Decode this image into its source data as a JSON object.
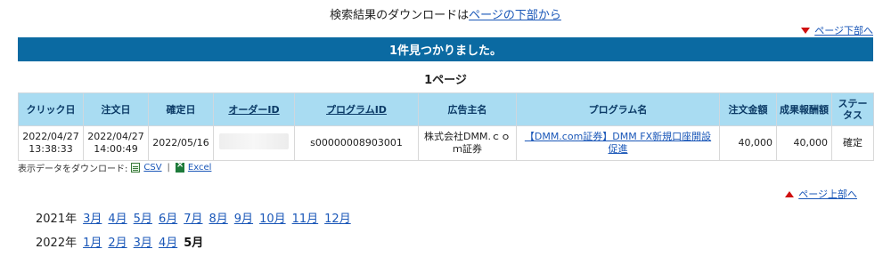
{
  "header": {
    "download_note_prefix": "検索結果のダウンロードは",
    "download_note_link": "ページの下部から",
    "page_bottom_link": "ページ下部へ"
  },
  "banner": {
    "text": "1件見つかりました。"
  },
  "page_count": "1ページ",
  "table": {
    "columns": [
      {
        "label": "クリック日",
        "sortable": false
      },
      {
        "label": "注文日",
        "sortable": false
      },
      {
        "label": "確定日",
        "sortable": false
      },
      {
        "label": "オーダーID",
        "sortable": true
      },
      {
        "label": "プログラムID",
        "sortable": true
      },
      {
        "label": "広告主名",
        "sortable": false
      },
      {
        "label": "プログラム名",
        "sortable": false
      },
      {
        "label": "注文金額",
        "sortable": false
      },
      {
        "label": "成果報酬額",
        "sortable": false
      },
      {
        "label": "ステータス",
        "sortable": false
      }
    ],
    "rows": [
      {
        "click_date": "2022/04/27",
        "click_time": "13:38:33",
        "order_date": "2022/04/27",
        "order_time": "14:00:49",
        "confirmed_date": "2022/05/16",
        "order_id": "",
        "program_id": "s00000008903001",
        "advertiser": "株式会社DMM.ｃｏｍ証券",
        "program_name": "【DMM.com証券】DMM FX新規口座開設促進",
        "order_amount": "40,000",
        "reward_amount": "40,000",
        "status": "確定"
      }
    ]
  },
  "download": {
    "label": "表示データをダウンロード:",
    "csv": "CSV",
    "separator": "|",
    "excel": "Excel"
  },
  "page_top_link": "ページ上部へ",
  "years": [
    {
      "year": "2021年",
      "months": [
        "3月",
        "4月",
        "5月",
        "6月",
        "7月",
        "8月",
        "9月",
        "10月",
        "11月",
        "12月"
      ],
      "current": ""
    },
    {
      "year": "2022年",
      "months": [
        "1月",
        "2月",
        "3月",
        "4月"
      ],
      "current": "5月"
    }
  ],
  "colors": {
    "banner_bg": "#0b6aa2",
    "header_bg": "#a9dcf2",
    "link": "#1a57b8",
    "arrow": "#d01010"
  }
}
